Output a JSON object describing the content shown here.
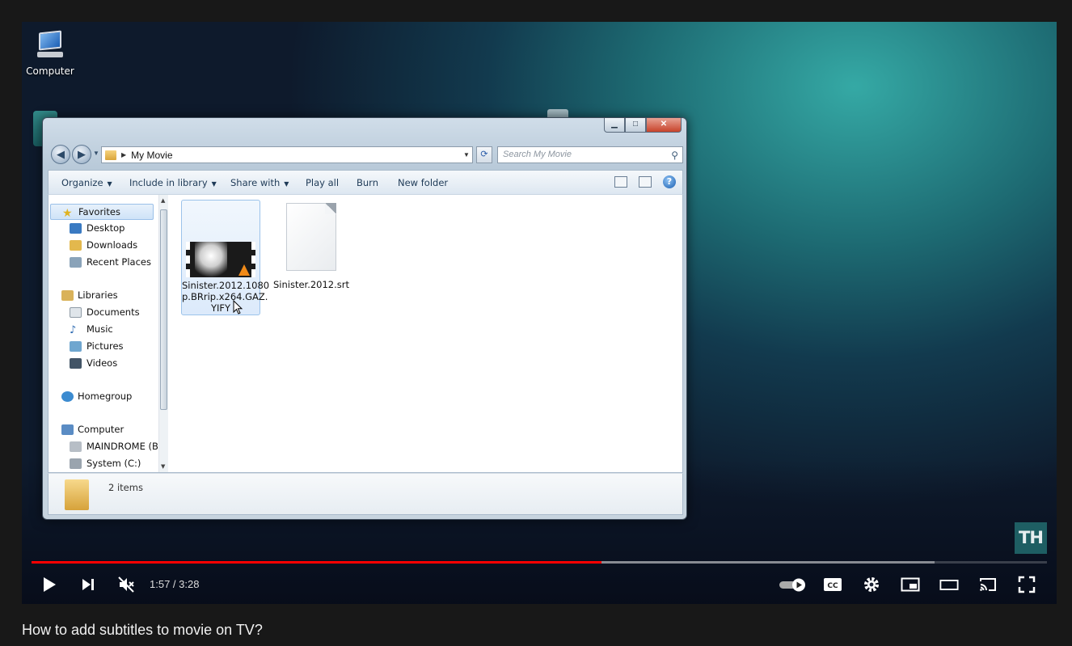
{
  "desktop": {
    "computer_label": "Computer"
  },
  "explorer": {
    "address_path": "My Movie",
    "search_placeholder": "Search My Movie",
    "window_buttons": {
      "minimize": "▁",
      "maximize": "□",
      "close": "✕"
    },
    "toolbar": {
      "organize": "Organize",
      "include": "Include in library",
      "share": "Share with",
      "play_all": "Play all",
      "burn": "Burn",
      "new_folder": "New folder"
    },
    "nav": {
      "favorites": "Favorites",
      "desktop": "Desktop",
      "downloads": "Downloads",
      "recent": "Recent Places",
      "libraries": "Libraries",
      "documents": "Documents",
      "music": "Music",
      "pictures": "Pictures",
      "videos": "Videos",
      "homegroup": "Homegroup",
      "computer": "Computer",
      "drive_b": "MAINDROME (B:",
      "drive_c": "System (C:)"
    },
    "files": [
      {
        "name_line1": "Sinister.2012.1080",
        "name_line2": "p.BRrip.x264.GAZ.",
        "name_line3": "YIFY"
      },
      {
        "name_line1": "Sinister.2012.srt"
      }
    ],
    "status": "2 items"
  },
  "watermark": "TH",
  "player": {
    "time": "1:57 / 3:28",
    "progress_played": 0.561,
    "progress_loaded": 0.889,
    "accent_color": "#ff0000"
  },
  "video_title": "How to add subtitles to movie on TV?"
}
